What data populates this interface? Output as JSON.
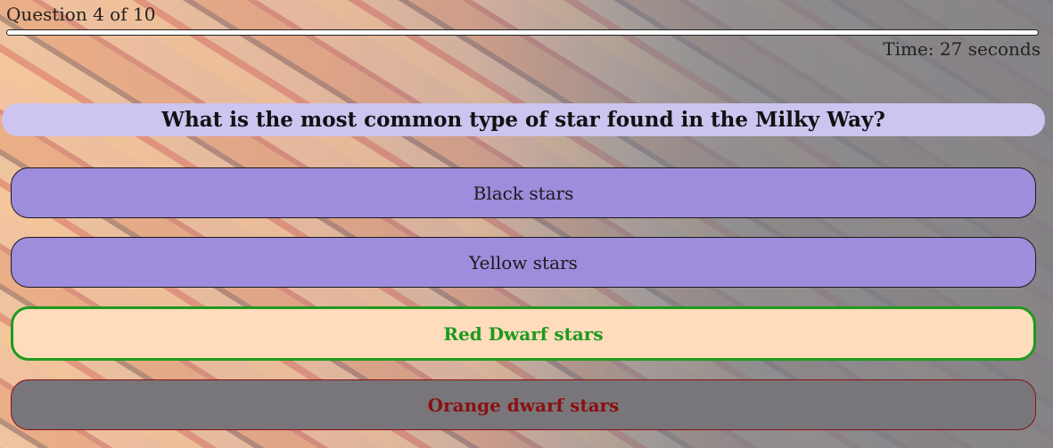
{
  "quiz": {
    "progress_label": "Question 4 of 10",
    "progress_fraction": 1.0,
    "timer_label": "Time: 27 seconds",
    "question": "What is the most common type of star found in the Milky Way?",
    "answers": [
      {
        "label": "Black stars",
        "state": "neutral"
      },
      {
        "label": "Yellow stars",
        "state": "neutral"
      },
      {
        "label": "Red Dwarf stars",
        "state": "correct"
      },
      {
        "label": "Orange dwarf stars",
        "state": "wrong"
      }
    ]
  },
  "colors": {
    "question_bg": "#cdc4f0",
    "answer_bg": "#9e8cdc",
    "correct": "#1e9a1e",
    "correct_bg": "#ffdcbc",
    "wrong": "#8a1010",
    "wrong_bg": "#78767b"
  }
}
